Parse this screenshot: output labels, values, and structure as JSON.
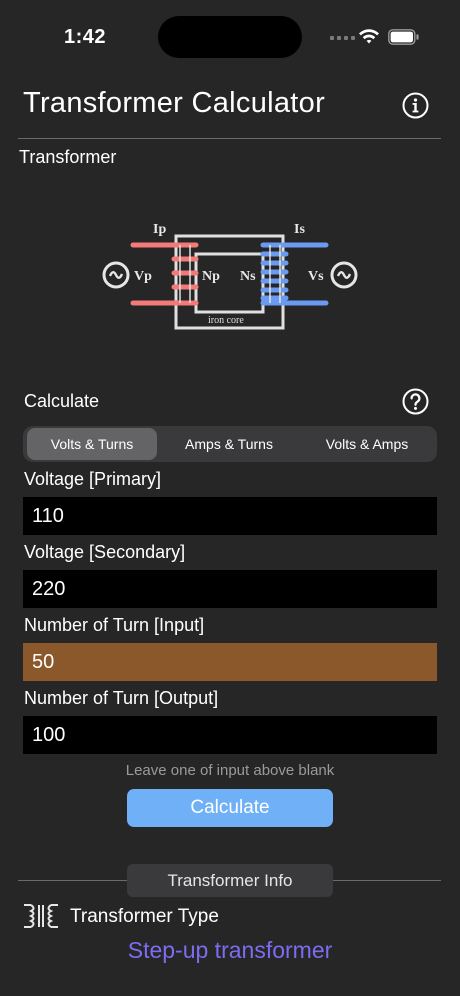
{
  "status": {
    "time": "1:42"
  },
  "header": {
    "title": "Transformer Calculator"
  },
  "diagram_section": {
    "label": "Transformer"
  },
  "diagram": {
    "ip": "Ip",
    "is": "Is",
    "vp": "Vp",
    "vs": "Vs",
    "np": "Np",
    "ns": "Ns",
    "core": "iron core",
    "primary_color": "#f47a7a",
    "secondary_color": "#6b9bf0"
  },
  "calculate_section": {
    "label": "Calculate"
  },
  "segments": [
    {
      "label": "Volts & Turns",
      "active": true
    },
    {
      "label": "Amps & Turns",
      "active": false
    },
    {
      "label": "Volts & Amps",
      "active": false
    }
  ],
  "fields": [
    {
      "label": "Voltage [Primary]",
      "value": "110"
    },
    {
      "label": "Voltage [Secondary]",
      "value": "220"
    },
    {
      "label": "Number of Turn [Input]",
      "value": "50"
    },
    {
      "label": "Number of Turn [Output]",
      "value": "100"
    }
  ],
  "hint": "Leave one of input above blank",
  "calculate_button": "Calculate",
  "info": {
    "tag": "Transformer Info",
    "type_label": "Transformer Type",
    "result": "Step-up transformer"
  },
  "colors": {
    "background": "#262626",
    "accent_button": "#6fb0f7",
    "highlight_field": "#8a582a",
    "result_text": "#7b6cf2"
  }
}
